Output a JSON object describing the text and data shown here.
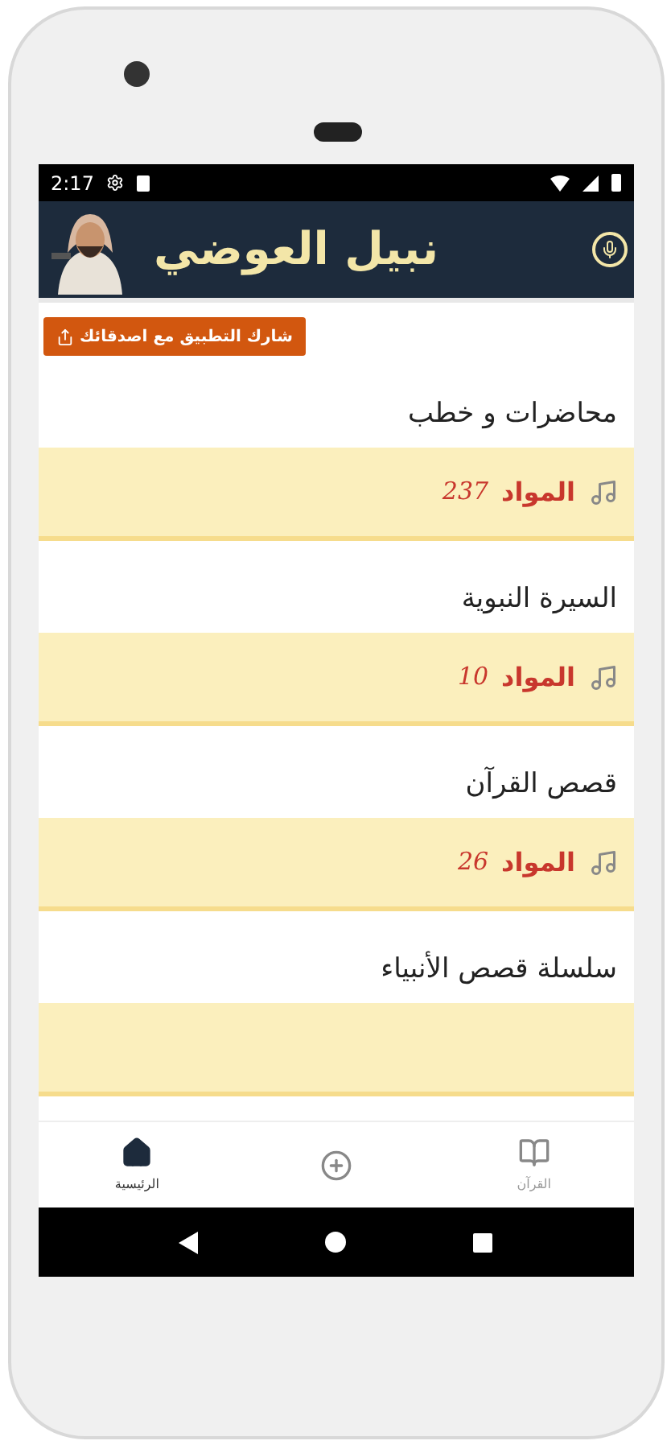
{
  "status_bar": {
    "time": "2:17"
  },
  "header": {
    "title": "نبيل العوضي"
  },
  "share_button": {
    "label": "شارك التطبيق مع اصدقائك"
  },
  "categories": [
    {
      "title": "محاضرات و خطب",
      "label": "المواد",
      "count": "237"
    },
    {
      "title": "السيرة النبوية",
      "label": "المواد",
      "count": "10"
    },
    {
      "title": "قصص القرآن",
      "label": "المواد",
      "count": "26"
    },
    {
      "title": "سلسلة قصص الأنبياء"
    }
  ],
  "bottom_nav": [
    {
      "kind": "book",
      "label": "القرآن",
      "selected": false
    },
    {
      "kind": "add",
      "selected": false
    },
    {
      "kind": "home",
      "label": "الرئيسية",
      "selected": true
    }
  ]
}
